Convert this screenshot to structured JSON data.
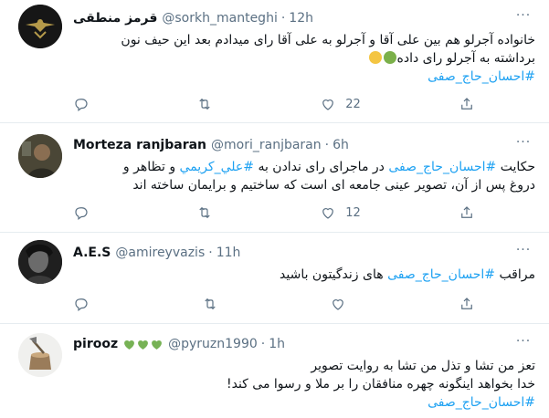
{
  "tweets": [
    {
      "name": "قرمز منطقی",
      "handle": "@sorkh_manteghi",
      "time": "12h",
      "lines": [
        "خانواده آجرلو هم بین علی آقا و آجرلو به علی آقا رای میدادم بعد این حیف نون",
        "برداشته به آجرلو رای داده"
      ],
      "hashtag": "#احسان_حاج_صفی",
      "reply_count": "",
      "retweet_count": "",
      "like_count": "22"
    },
    {
      "name": "Morteza ranjbaran",
      "handle": "@mori_ranjbaran",
      "time": "6h",
      "line1_before": "حکایت",
      "line1_tag": "#احسان_حاج_صفی",
      "line1_mid": "در ماجرای رای ندادن به",
      "line1_tag2": "#علي_كريمي",
      "line1_after": "و تظاهر و",
      "line2": "دروغ پس از آن، تصویر عینی جامعه ای است که ساختیم و برایمان ساخته اند",
      "reply_count": "",
      "retweet_count": "",
      "like_count": "12"
    },
    {
      "name": "A.E.S",
      "handle": "@amireyvazis",
      "time": "11h",
      "before": "مراقب",
      "tag": "#احسان_حاج_صفی",
      "after": "های زندگیتون باشید",
      "reply_count": "",
      "retweet_count": "",
      "like_count": ""
    },
    {
      "name": "pirooz",
      "handle": "@pyruzn1990",
      "time": "1h",
      "lines": [
        "تعز من تشا و تذل من تشا به روایت تصویر",
        "خدا بخواهد اینگونه چهره منافقان را بر ملا و رسوا می کند!"
      ],
      "hashtag": "#احسان_حاج_صفی"
    }
  ],
  "dot": "·",
  "more_glyph": "···",
  "colors": {
    "link": "#1da1f2",
    "secondary": "#5b7083",
    "heart_green": "#77b255"
  },
  "icons": [
    "reply-icon",
    "retweet-icon",
    "like-icon",
    "share-icon",
    "more-icon"
  ]
}
